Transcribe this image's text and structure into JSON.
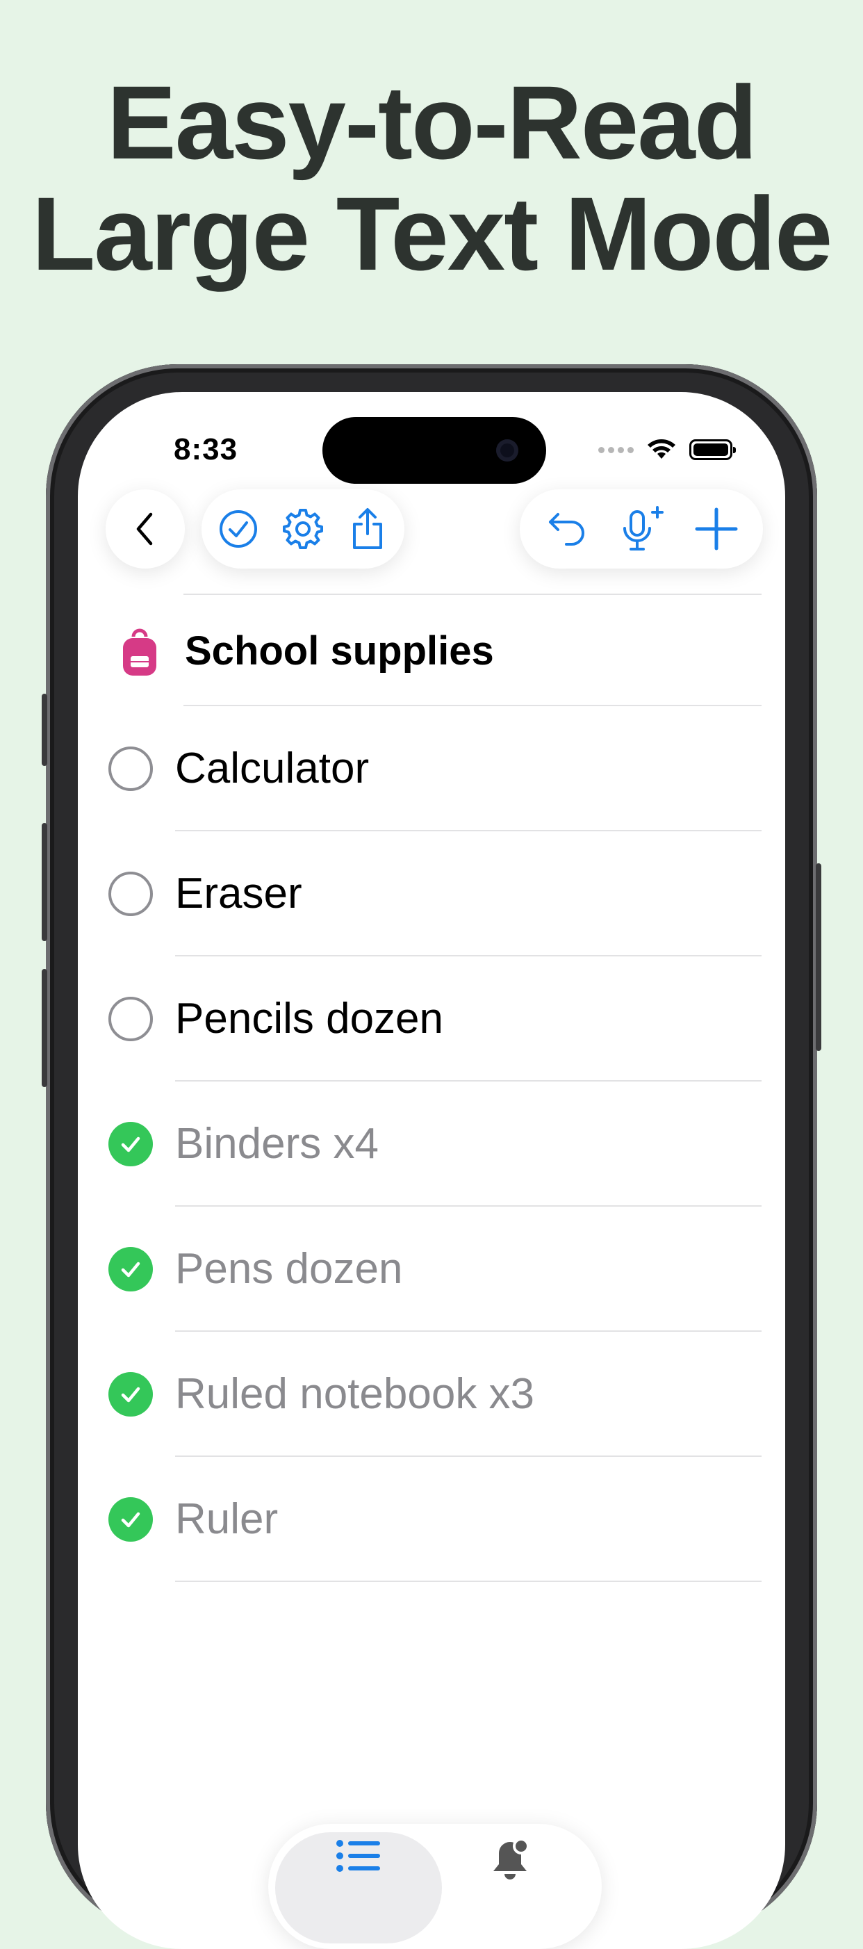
{
  "headline": {
    "line1": "Easy-to-Read",
    "line2": "Large Text Mode"
  },
  "status_bar": {
    "time": "8:33"
  },
  "toolbar": {
    "icons": [
      "back-chevron-icon",
      "checkmark-circle-icon",
      "gear-icon",
      "share-icon",
      "undo-icon",
      "microphone-plus-icon",
      "plus-icon"
    ],
    "accent": "#1a7fe8"
  },
  "list": {
    "title": "School supplies",
    "icon": "backpack-icon",
    "icon_color": "#d63a86",
    "items": [
      {
        "label": "Calculator",
        "done": false
      },
      {
        "label": "Eraser",
        "done": false
      },
      {
        "label": "Pencils dozen",
        "done": false
      },
      {
        "label": "Binders x4",
        "done": true
      },
      {
        "label": "Pens dozen",
        "done": true
      },
      {
        "label": "Ruled notebook x3",
        "done": true
      },
      {
        "label": "Ruler",
        "done": true
      }
    ],
    "done_color": "#34c759"
  },
  "tabbar": {
    "tabs": [
      {
        "icon": "list-icon",
        "active": true
      },
      {
        "icon": "bell-badge-icon",
        "active": false
      }
    ]
  }
}
